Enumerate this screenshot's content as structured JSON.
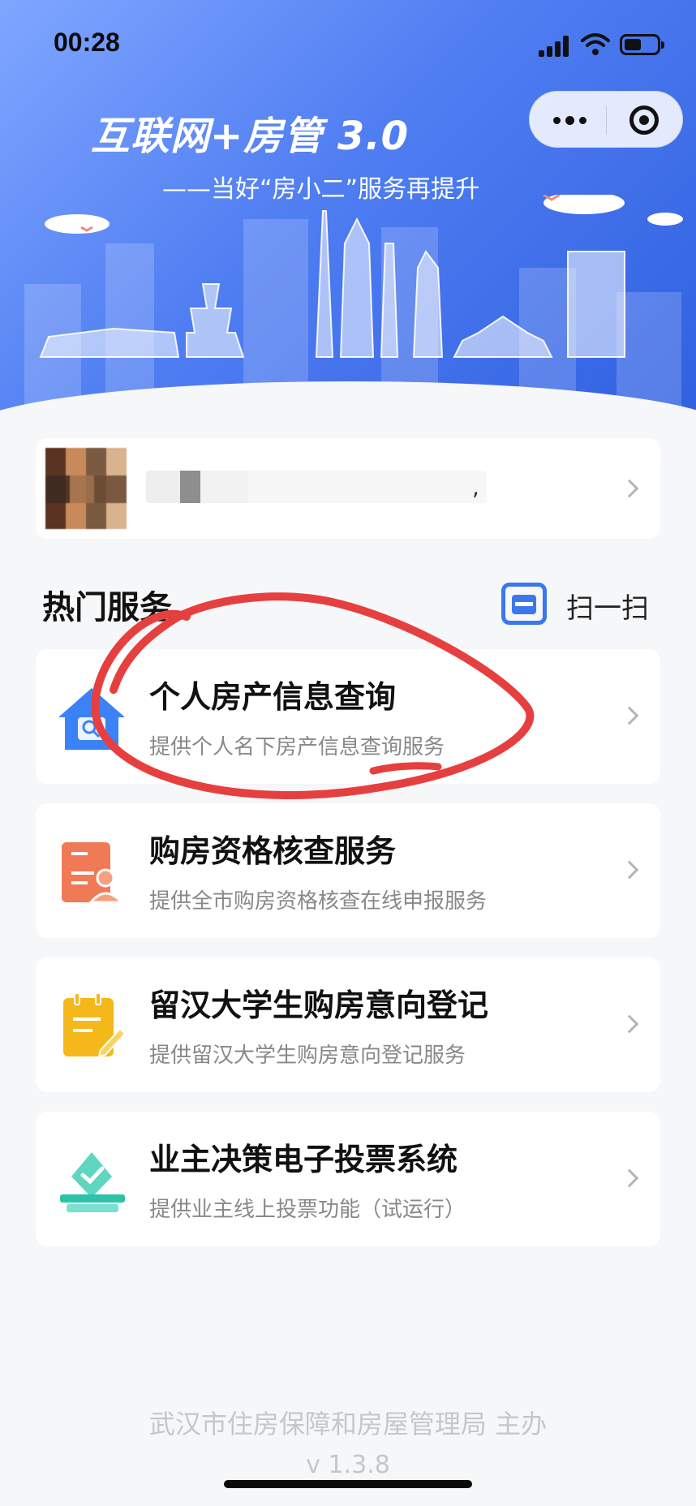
{
  "status_bar": {
    "time": "00:28"
  },
  "banner": {
    "title": "互联网+房管  3.0",
    "subtitle": "——当好“房小二”服务再提升"
  },
  "user_card": {
    "comma": ","
  },
  "hot_services": {
    "title": "热门服务",
    "scan_label": "扫一扫"
  },
  "services": [
    {
      "title": "个人房产信息查询",
      "desc": "提供个人名下房产信息查询服务",
      "icon": "house-search-icon",
      "color": "#3b82f6"
    },
    {
      "title": "购房资格核查服务",
      "desc": "提供全市购房资格核查在线申报服务",
      "icon": "document-person-icon",
      "color": "#f07a55"
    },
    {
      "title": "留汉大学生购房意向登记",
      "desc": "提供留汉大学生购房意向登记服务",
      "icon": "notepad-pencil-icon",
      "color": "#f5b81b"
    },
    {
      "title": "业主决策电子投票系统",
      "desc": "提供业主线上投票功能（试运行）",
      "icon": "ballot-box-icon",
      "color": "#2cc3a8"
    }
  ],
  "footer": {
    "organizer": "武汉市住房保障和房屋管理局 主办",
    "version": "v 1.3.8"
  },
  "colors": {
    "accent": "#3b78f0",
    "annotation": "#e5403f"
  }
}
